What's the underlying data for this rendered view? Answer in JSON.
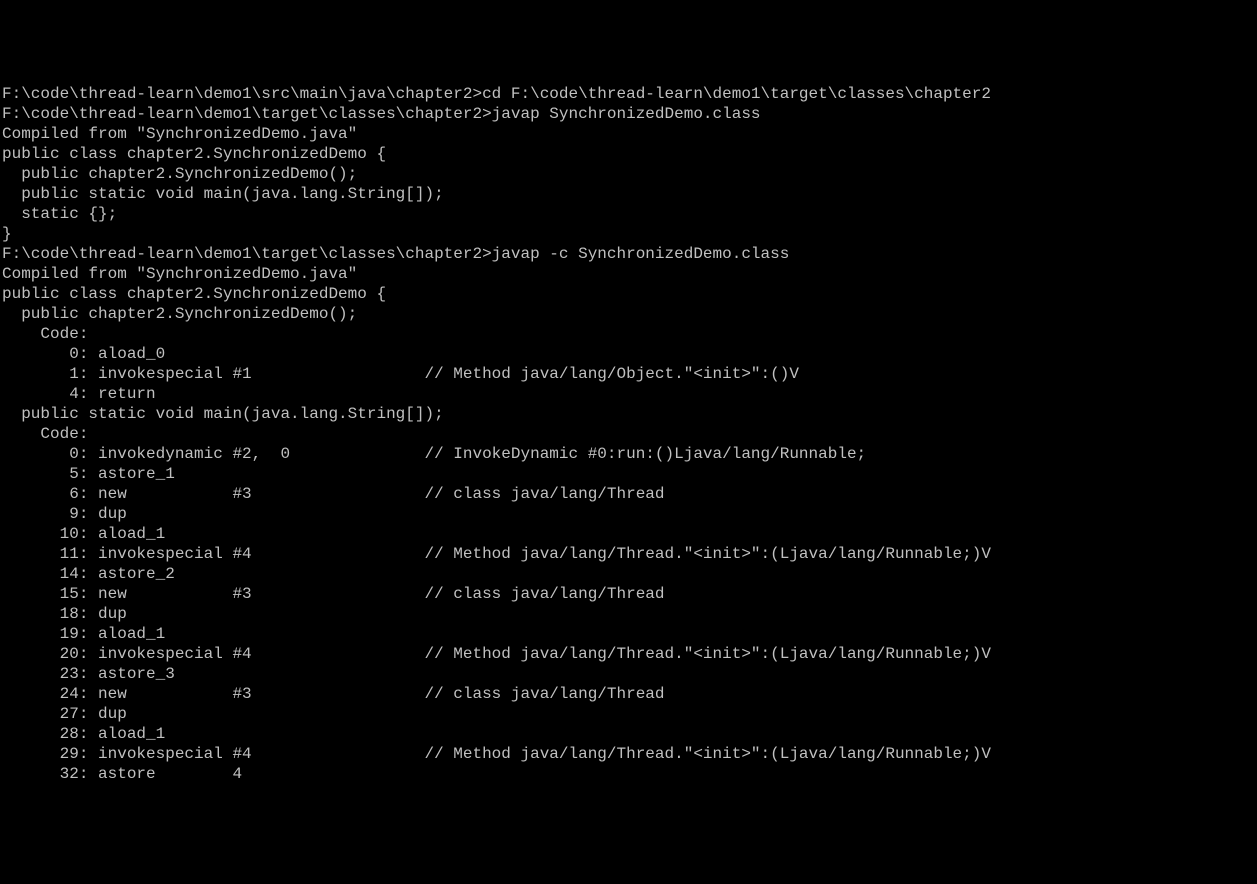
{
  "terminal": {
    "lines": [
      "",
      "F:\\code\\thread-learn\\demo1\\src\\main\\java\\chapter2>cd F:\\code\\thread-learn\\demo1\\target\\classes\\chapter2",
      "",
      "F:\\code\\thread-learn\\demo1\\target\\classes\\chapter2>javap SynchronizedDemo.class",
      "Compiled from \"SynchronizedDemo.java\"",
      "public class chapter2.SynchronizedDemo {",
      "  public chapter2.SynchronizedDemo();",
      "  public static void main(java.lang.String[]);",
      "  static {};",
      "}",
      "",
      "F:\\code\\thread-learn\\demo1\\target\\classes\\chapter2>javap -c SynchronizedDemo.class",
      "Compiled from \"SynchronizedDemo.java\"",
      "public class chapter2.SynchronizedDemo {",
      "  public chapter2.SynchronizedDemo();",
      "    Code:",
      "       0: aload_0",
      "       1: invokespecial #1                  // Method java/lang/Object.\"<init>\":()V",
      "       4: return",
      "",
      "  public static void main(java.lang.String[]);",
      "    Code:",
      "       0: invokedynamic #2,  0              // InvokeDynamic #0:run:()Ljava/lang/Runnable;",
      "       5: astore_1",
      "       6: new           #3                  // class java/lang/Thread",
      "       9: dup",
      "      10: aload_1",
      "      11: invokespecial #4                  // Method java/lang/Thread.\"<init>\":(Ljava/lang/Runnable;)V",
      "      14: astore_2",
      "      15: new           #3                  // class java/lang/Thread",
      "      18: dup",
      "      19: aload_1",
      "      20: invokespecial #4                  // Method java/lang/Thread.\"<init>\":(Ljava/lang/Runnable;)V",
      "      23: astore_3",
      "      24: new           #3                  // class java/lang/Thread",
      "      27: dup",
      "      28: aload_1",
      "      29: invokespecial #4                  // Method java/lang/Thread.\"<init>\":(Ljava/lang/Runnable;)V",
      "      32: astore        4"
    ]
  }
}
